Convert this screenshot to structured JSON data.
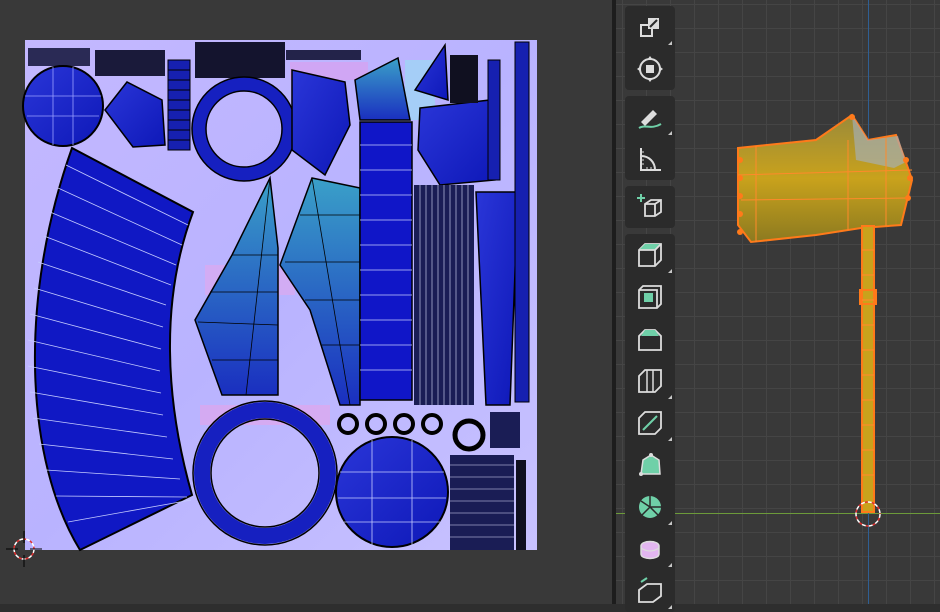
{
  "uv_editor": {
    "cursor": "2d-cursor-icon"
  },
  "viewport": {
    "object": "axe-mesh",
    "origin": "3d-cursor-icon",
    "colors": {
      "mesh_fill": "#b89a2a",
      "selection_outline": "#ff7a1a",
      "axis_x": "#6c9a3a",
      "axis_z": "#2f5f93"
    }
  },
  "toolbar": {
    "tools": [
      {
        "icon": "scale-icon"
      },
      {
        "icon": "transform-icon"
      },
      {
        "icon": "annotate-icon"
      },
      {
        "icon": "measure-icon"
      },
      {
        "icon": "add-cube-icon"
      },
      {
        "icon": "extrude-region-icon"
      },
      {
        "icon": "inset-faces-icon"
      },
      {
        "icon": "bevel-icon"
      },
      {
        "icon": "loop-cut-icon"
      },
      {
        "icon": "knife-icon"
      },
      {
        "icon": "poly-build-icon"
      },
      {
        "icon": "spin-icon"
      },
      {
        "icon": "smooth-icon"
      },
      {
        "icon": "edge-slide-icon"
      }
    ]
  }
}
